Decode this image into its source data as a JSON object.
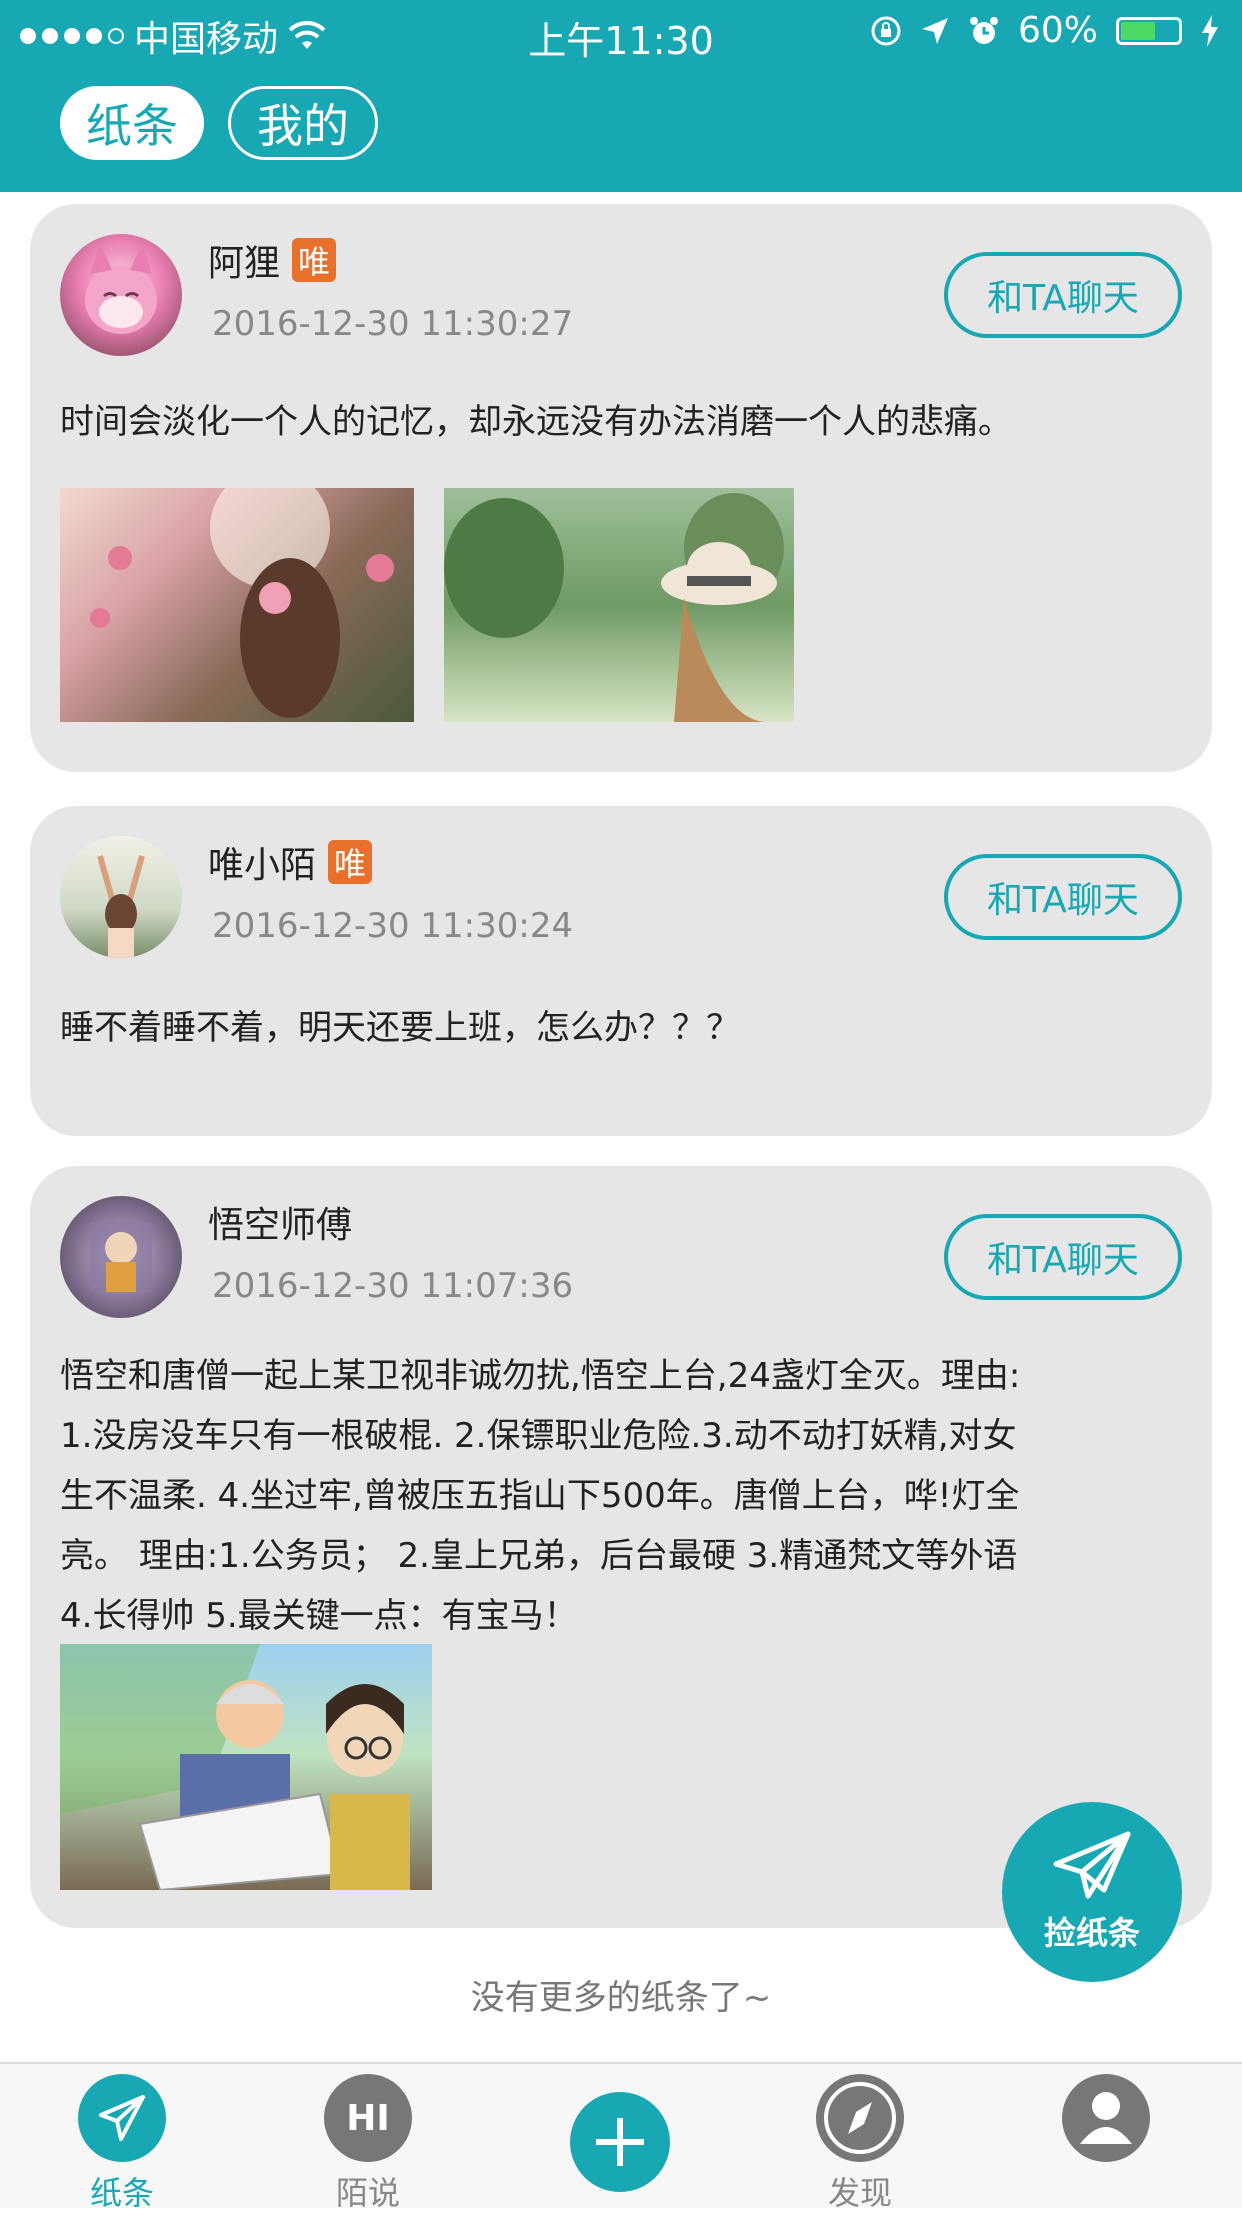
{
  "status_bar": {
    "carrier": "中国移动",
    "time": "上午11:30",
    "battery": "60%",
    "battery_level": 0.6
  },
  "top_tabs": [
    {
      "label": "纸条",
      "active": true
    },
    {
      "label": "我的",
      "active": false
    }
  ],
  "posts": [
    {
      "name": "阿狸",
      "vip_badge": "唯",
      "timestamp": "2016-12-30 11:30:27",
      "chat_label": "和TA聊天",
      "text": "时间会淡化一个人的记忆，却永远没有办法消磨一个人的悲痛。"
    },
    {
      "name": "唯小陌",
      "vip_badge": "唯",
      "timestamp": "2016-12-30 11:30:24",
      "chat_label": "和TA聊天",
      "text": "睡不着睡不着，明天还要上班，怎么办？？？"
    },
    {
      "name": "悟空师傅",
      "timestamp": "2016-12-30 11:07:36",
      "chat_label": "和TA聊天",
      "text_lines": [
        "悟空和唐僧一起上某卫视非诚勿扰,悟空上台,24盏灯全灭。理由:",
        "1.没房没车只有一根破棍. 2.保镖职业危险.3.动不动打妖精,对女",
        "生不温柔. 4.坐过牢,曾被压五指山下500年。唐僧上台，哗!灯全",
        "亮。 理由:1.公务员； 2.皇上兄弟，后台最硬 3.精通梵文等外语",
        "4.长得帅 5.最关键一点：有宝马！"
      ]
    }
  ],
  "no_more_text": "没有更多的纸条了~",
  "fab_label": "捡纸条",
  "bottom_nav": [
    {
      "label": "纸条",
      "icon": "paper-plane-icon",
      "active": true
    },
    {
      "label": "陌说",
      "icon": "hi-bubble-icon",
      "icon_text": "HI",
      "active": false
    },
    {
      "label": "",
      "icon": "plus-icon",
      "active": false
    },
    {
      "label": "发现",
      "icon": "compass-icon",
      "active": false
    },
    {
      "label": "",
      "icon": "user-icon",
      "active": false
    }
  ],
  "colors": {
    "accent": "#17a8b3",
    "card_bg": "#e6e6e6",
    "vip_badge": "#e8702a"
  }
}
